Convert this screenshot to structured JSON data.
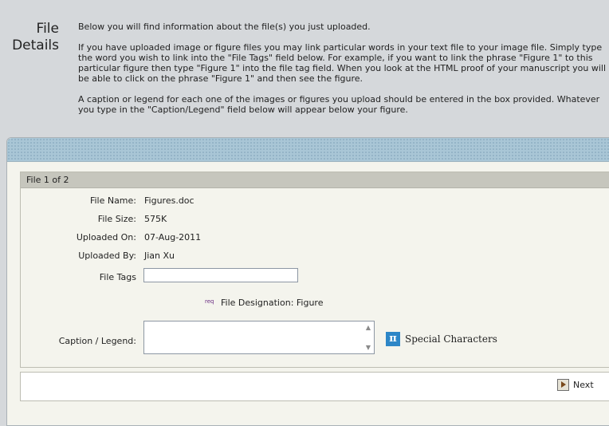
{
  "header": {
    "title_line1": "File",
    "title_line2": "Details",
    "paragraph1": "Below you will find information about the file(s) you just uploaded.",
    "paragraph2": "If you have uploaded image or figure files you may link particular words in your text file to your image file. Simply type the word you wish to link into the \"File Tags\" field below. For example, if you want to link the phrase \"Figure 1\" to this particular figure then type \"Figure 1\" into the file tag field. When you look at the HTML proof of your manuscript you will be able to click on the phrase \"Figure 1\" and then see the figure.",
    "paragraph3": "A caption or legend for each one of the images or figures you upload should be entered in the box provided. Whatever you type in the \"Caption/Legend\" field below will appear below your figure."
  },
  "file": {
    "heading": "File 1 of 2",
    "name_label": "File Name:",
    "name_value": "Figures.doc",
    "size_label": "File Size:",
    "size_value": "575K",
    "uploaded_on_label": "Uploaded On:",
    "uploaded_on_value": "07-Aug-2011",
    "uploaded_by_label": "Uploaded By:",
    "uploaded_by_value": "Jian Xu",
    "tags_label": "File Tags",
    "tags_value": "",
    "req_label": "req",
    "designation": "File Designation: Figure",
    "caption_label": "Caption / Legend:",
    "caption_value": "",
    "special_chars_label": "Special Characters",
    "pi_glyph": "π",
    "scroll_up_glyph": "▲",
    "scroll_down_glyph": "▼"
  },
  "footer": {
    "next_label": "Next"
  },
  "icons": {
    "special_chars": "pi-icon",
    "next": "arrow-right-icon"
  },
  "colors": {
    "band": "#a9c6d6",
    "pi_icon": "#2d86c7",
    "req": "#6a2d82",
    "page_background": "#d5d8db",
    "panel_background": "#f4f4ed"
  }
}
